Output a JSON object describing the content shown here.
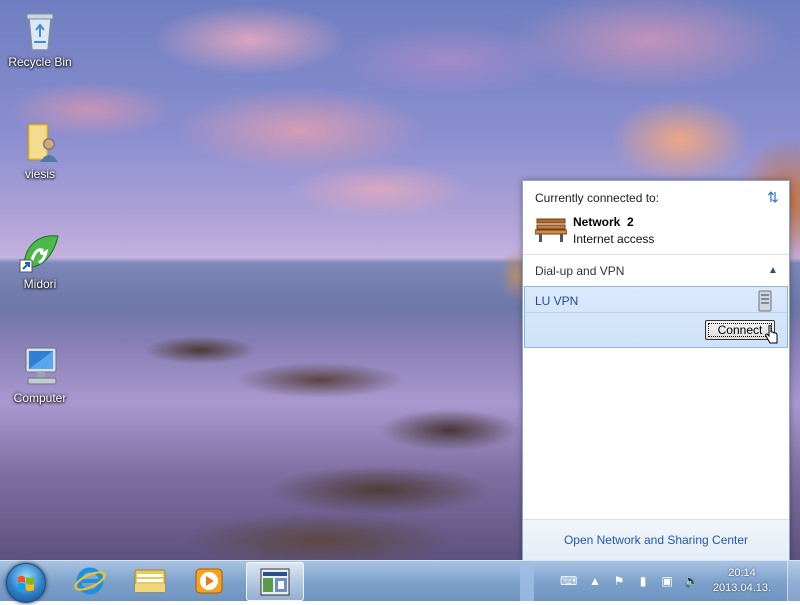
{
  "desktop": {
    "icons": [
      {
        "label": "Recycle Bin",
        "icon": "recycle-bin-icon"
      },
      {
        "label": "viesis",
        "icon": "user-folder-icon"
      },
      {
        "label": "Midori",
        "icon": "midori-browser-icon"
      },
      {
        "label": "Computer",
        "icon": "computer-icon"
      }
    ]
  },
  "flyout": {
    "title": "Currently connected to:",
    "network": {
      "name": "Network  2",
      "status": "Internet access"
    },
    "group_header": "Dial-up and VPN",
    "vpn": {
      "name": "LU VPN",
      "connect_label": "Connect"
    },
    "footer_link": "Open Network and Sharing Center"
  },
  "taskbar": {
    "apps": [
      {
        "icon": "internet-explorer-icon"
      },
      {
        "icon": "file-explorer-icon"
      },
      {
        "icon": "media-player-icon"
      },
      {
        "icon": "control-panel-icon",
        "active": true
      }
    ],
    "tray": {
      "time": "20:14",
      "date": "2013.04.13.",
      "icons": [
        "keyboard-icon",
        "show-hidden-icons-icon",
        "action-center-flag-icon",
        "power-icon",
        "network-icon",
        "volume-icon"
      ]
    }
  },
  "colors": {
    "link": "#1f57b2",
    "vpn_highlight": "#cfe2fa",
    "taskbar": "#7fa2cc"
  }
}
